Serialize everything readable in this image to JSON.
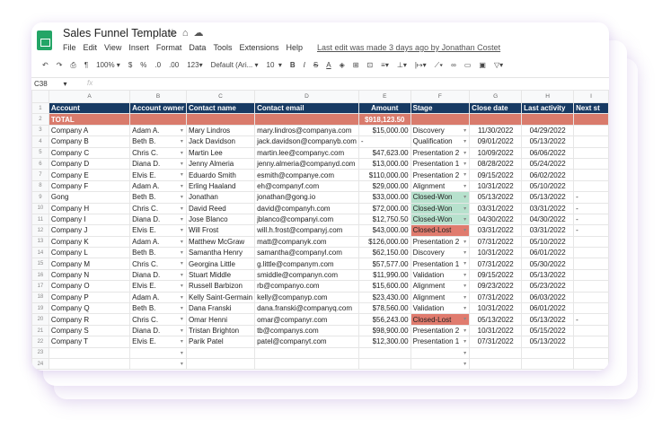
{
  "app": {
    "title": "Sales Funnel Template",
    "title_icons": [
      "star-icon",
      "move-icon",
      "cloud-icon"
    ],
    "menu": [
      "File",
      "Edit",
      "View",
      "Insert",
      "Format",
      "Data",
      "Tools",
      "Extensions",
      "Help"
    ],
    "last_edit": "Last edit was made 3 days ago by Jonathan Costet"
  },
  "toolbar": {
    "zoom": "100%",
    "currency": "$",
    "percent": "%",
    "dec_less": ".0",
    "dec_more": ".00",
    "format": "123",
    "font": "Default (Ari...",
    "size": "10",
    "bold": "B",
    "italic": "I",
    "strike": "S",
    "text_color": "A"
  },
  "formula": {
    "cell_ref": "C38",
    "fx": "fx",
    "value": ""
  },
  "columns": [
    "A",
    "B",
    "C",
    "D",
    "E",
    "F",
    "G",
    "H",
    "I"
  ],
  "headers": [
    "Account",
    "Account owner",
    "Contact name",
    "Contact email",
    "Amount",
    "Stage",
    "Close date",
    "Last activity",
    "Next st"
  ],
  "total": {
    "label": "TOTAL",
    "amount": "$918,123.50"
  },
  "rows": [
    [
      "Company A",
      "Adam A.",
      "Mary Lindros",
      "mary.lindros@companya.com",
      "$15,000.00",
      "Discovery",
      "11/30/2022",
      "04/29/2022",
      ""
    ],
    [
      "Company B",
      "Beth B.",
      "Jack Davidson",
      "jack.davidson@companyb.com",
      "-",
      "Qualification",
      "09/01/2022",
      "05/13/2022",
      ""
    ],
    [
      "Company C",
      "Chris C.",
      "Martin Lee",
      "martin.lee@companyc.com",
      "$47,623.00",
      "Presentation 2",
      "10/09/2022",
      "06/06/2022",
      ""
    ],
    [
      "Company D",
      "Diana D.",
      "Jenny Almeria",
      "jenny.almeria@companyd.com",
      "$13,000.00",
      "Presentation 1",
      "08/28/2022",
      "05/24/2022",
      ""
    ],
    [
      "Company E",
      "Elvis E.",
      "Eduardo Smith",
      "esmith@companye.com",
      "$110,000.00",
      "Presentation 2",
      "09/15/2022",
      "06/02/2022",
      ""
    ],
    [
      "Company F",
      "Adam A.",
      "Erling Haaland",
      "eh@companyf.com",
      "$29,000.00",
      "Alignment",
      "10/31/2022",
      "05/10/2022",
      ""
    ],
    [
      "Gong",
      "Beth B.",
      "Jonathan",
      "jonathan@gong.io",
      "$33,000.00",
      "Closed-Won",
      "05/13/2022",
      "05/13/2022",
      "-"
    ],
    [
      "Company H",
      "Chris C.",
      "David Reed",
      "david@companyh.com",
      "$72,000.00",
      "Closed-Won",
      "03/31/2022",
      "03/31/2022",
      "-"
    ],
    [
      "Company I",
      "Diana D.",
      "Jose Blanco",
      "jblanco@companyi.com",
      "$12,750.50",
      "Closed-Won",
      "04/30/2022",
      "04/30/2022",
      "-"
    ],
    [
      "Company J",
      "Elvis E.",
      "Will Frost",
      "will.h.frost@companyj.com",
      "$43,000.00",
      "Closed-Lost",
      "03/31/2022",
      "03/31/2022",
      "-"
    ],
    [
      "Company K",
      "Adam A.",
      "Matthew McGraw",
      "matt@companyk.com",
      "$126,000.00",
      "Presentation 2",
      "07/31/2022",
      "05/10/2022",
      ""
    ],
    [
      "Company L",
      "Beth B.",
      "Samantha Henry",
      "samantha@companyl.com",
      "$62,150.00",
      "Discovery",
      "10/31/2022",
      "06/01/2022",
      ""
    ],
    [
      "Company M",
      "Chris C.",
      "Georgina Little",
      "g.little@companym.com",
      "$57,577.00",
      "Presentation 1",
      "07/31/2022",
      "05/30/2022",
      ""
    ],
    [
      "Company N",
      "Diana D.",
      "Stuart Middle",
      "smiddle@companyn.com",
      "$11,990.00",
      "Validation",
      "09/15/2022",
      "05/13/2022",
      ""
    ],
    [
      "Company O",
      "Elvis E.",
      "Russell Barbizon",
      "rb@companyo.com",
      "$15,600.00",
      "Alignment",
      "09/23/2022",
      "05/23/2022",
      ""
    ],
    [
      "Company P",
      "Adam A.",
      "Kelly Saint-Germain",
      "kelly@companyp.com",
      "$23,430.00",
      "Alignment",
      "07/31/2022",
      "06/03/2022",
      ""
    ],
    [
      "Company Q",
      "Beth B.",
      "Dana Franski",
      "dana.franski@companyq.com",
      "$78,560.00",
      "Validation",
      "10/31/2022",
      "06/01/2022",
      ""
    ],
    [
      "Company R",
      "Chris C.",
      "Omar Henni",
      "omar@companyr.com",
      "$56,243.00",
      "Closed-Lost",
      "05/13/2022",
      "05/13/2022",
      "-"
    ],
    [
      "Company S",
      "Diana D.",
      "Tristan Brighton",
      "tb@companys.com",
      "$98,900.00",
      "Presentation 2",
      "10/31/2022",
      "05/15/2022",
      ""
    ],
    [
      "Company T",
      "Elvis E.",
      "Parik Patel",
      "patel@companyt.com",
      "$12,300.00",
      "Presentation 1",
      "07/31/2022",
      "05/13/2022",
      ""
    ],
    [
      "",
      "",
      "",
      "",
      "",
      "",
      "",
      "",
      ""
    ],
    [
      "",
      "",
      "",
      "",
      "",
      "",
      "",
      "",
      ""
    ]
  ],
  "colors": {
    "header": "#173a63",
    "total": "#d97b6c",
    "won": "#b7e1cd",
    "lost": "#e07b6e"
  }
}
